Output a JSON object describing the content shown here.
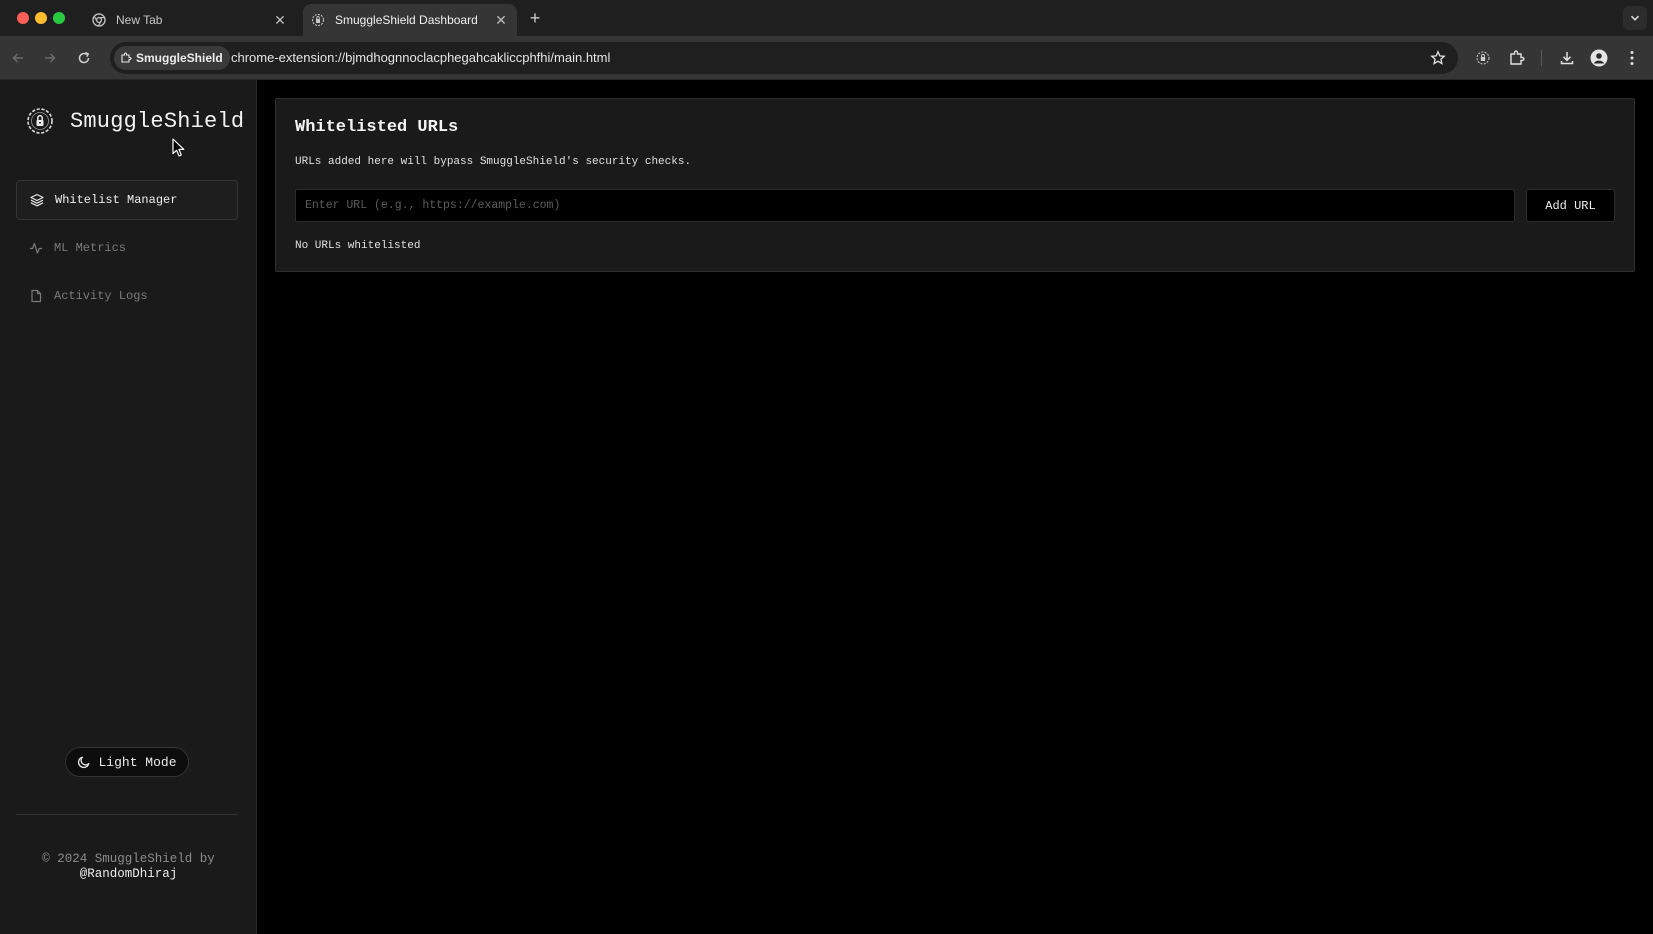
{
  "browser": {
    "tabs": [
      {
        "title": "New Tab",
        "active": false
      },
      {
        "title": "SmuggleShield Dashboard",
        "active": true
      }
    ],
    "site_chip": "SmuggleShield",
    "url": "chrome-extension://bjmdhognnoclacphegahcakliccphfhi/main.html"
  },
  "sidebar": {
    "brand": "SmuggleShield",
    "items": [
      {
        "label": "Whitelist Manager",
        "icon": "layers-icon",
        "active": true
      },
      {
        "label": "ML Metrics",
        "icon": "activity-icon",
        "active": false
      },
      {
        "label": "Activity Logs",
        "icon": "file-icon",
        "active": false
      }
    ],
    "theme_toggle": "Light Mode",
    "footer_line": "© 2024 SmuggleShield by",
    "footer_handle": "@RandomDhiraj"
  },
  "main": {
    "title": "Whitelisted URLs",
    "description": "URLs added here will bypass SmuggleShield's security checks.",
    "input_placeholder": "Enter URL (e.g., https://example.com)",
    "add_button": "Add URL",
    "empty_message": "No URLs whitelisted"
  },
  "colors": {
    "background": "#000000",
    "sidebar": "#1a1a1a",
    "card": "#1a1a1a",
    "border": "#2e2e2e",
    "text": "#f0f0f0",
    "muted": "#7a7a7a"
  }
}
